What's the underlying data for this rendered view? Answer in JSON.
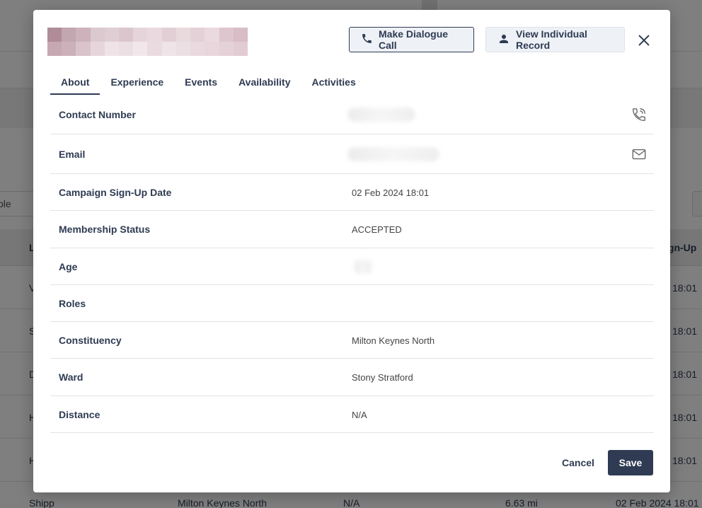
{
  "background": {
    "search_partial_text": "ble",
    "table_header_fragments": [
      "L",
      "ign-Up"
    ],
    "rows": [
      {
        "first": "V",
        "time": "18:01"
      },
      {
        "first": "S",
        "time": "18:01"
      },
      {
        "first": "D",
        "time": "18:01"
      },
      {
        "first": "H",
        "time": "18:01"
      },
      {
        "first": "H",
        "time": "18:01"
      }
    ],
    "last_row": {
      "name": "Shipp",
      "constituency": "Milton Keynes North",
      "value": "N/A",
      "distance": "6.63 mi",
      "date": "02 Feb 2024 18:01"
    }
  },
  "modal": {
    "header_buttons": {
      "make_call": "Make Dialogue Call",
      "view_record": "View Individual Record"
    },
    "tabs": [
      {
        "label": "About",
        "active": true
      },
      {
        "label": "Experience",
        "active": false
      },
      {
        "label": "Events",
        "active": false
      },
      {
        "label": "Availability",
        "active": false
      },
      {
        "label": "Activities",
        "active": false
      }
    ],
    "fields": {
      "contact_number": {
        "label": "Contact Number"
      },
      "email": {
        "label": "Email"
      },
      "signup_date": {
        "label": "Campaign Sign-Up Date",
        "value": "02 Feb 2024 18:01"
      },
      "membership_status": {
        "label": "Membership Status",
        "value": "ACCEPTED"
      },
      "age": {
        "label": "Age"
      },
      "roles": {
        "label": "Roles",
        "value": ""
      },
      "constituency": {
        "label": "Constituency",
        "value": "Milton Keynes North"
      },
      "ward": {
        "label": "Ward",
        "value": "Stony Stratford"
      },
      "distance": {
        "label": "Distance",
        "value": "N/A"
      }
    },
    "footer": {
      "cancel": "Cancel",
      "save": "Save"
    }
  },
  "icons": [
    "phone-icon",
    "person-icon",
    "close-icon",
    "phone-callback-icon",
    "mail-icon"
  ],
  "colors": {
    "primary": "#2e3b52",
    "button_bg": "#eef1f6",
    "overlay": "rgba(0,0,0,0.5)"
  }
}
